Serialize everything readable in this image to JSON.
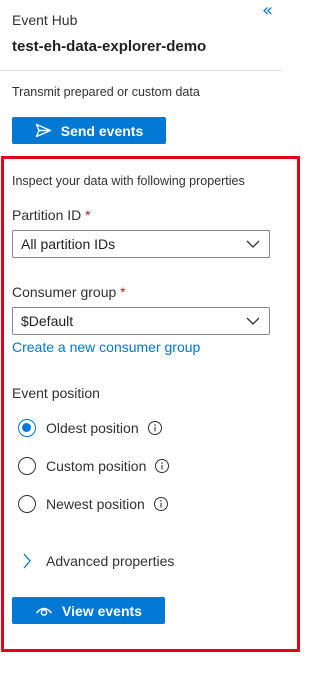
{
  "header": {
    "collapse_glyph": "«",
    "resource_type": "Event Hub",
    "resource_name": "test-eh-data-explorer-demo"
  },
  "send": {
    "description": "Transmit prepared or custom data",
    "button_label": "Send events",
    "button_icon": "send-icon"
  },
  "inspect": {
    "description": "Inspect your data with following properties",
    "partition": {
      "label": "Partition ID",
      "required_mark": "*",
      "value": "All partition IDs"
    },
    "consumer_group": {
      "label": "Consumer group",
      "required_mark": "*",
      "value": "$Default",
      "create_link": "Create a new consumer group"
    },
    "event_position": {
      "label": "Event position",
      "options": [
        {
          "label": "Oldest position",
          "selected": true
        },
        {
          "label": "Custom position",
          "selected": false
        },
        {
          "label": "Newest position",
          "selected": false
        }
      ]
    },
    "advanced": {
      "label": "Advanced properties",
      "expanded": false
    },
    "view_button": {
      "label": "View events",
      "icon": "eye-icon"
    }
  },
  "colors": {
    "accent": "#0078d4",
    "highlight_border": "#e3001b",
    "required": "#a4262c"
  }
}
